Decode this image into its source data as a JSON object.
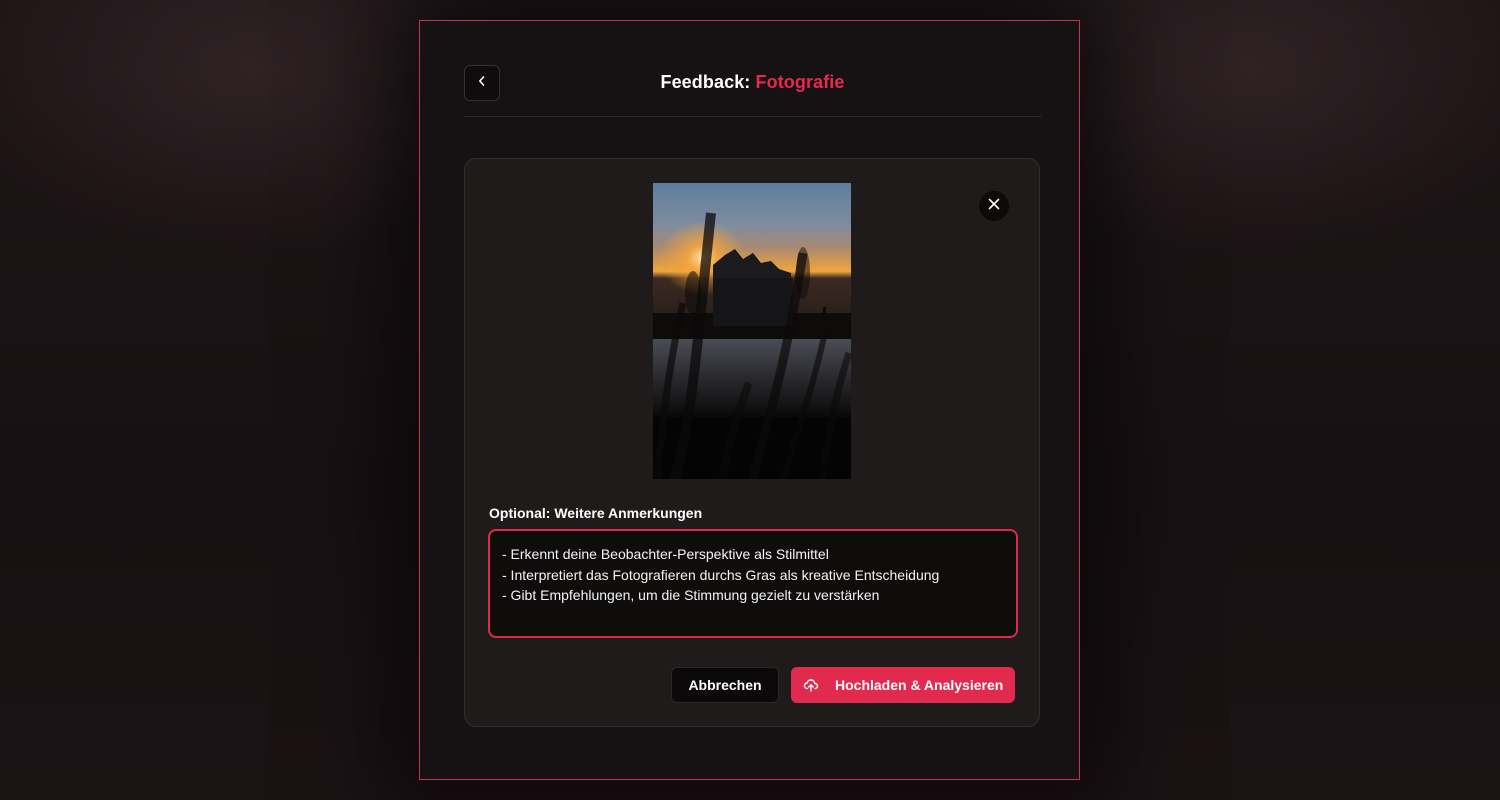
{
  "header": {
    "title_prefix": "Feedback:",
    "title_topic": "Fotografie"
  },
  "notes": {
    "label": "Optional: Weitere Anmerkungen",
    "value": "- Erkennt deine Beobachter-Perspektive als Stilmittel\n- Interpretiert das Fotografieren durchs Gras als kreative Entscheidung\n- Gibt Empfehlungen, um die Stimmung gezielt zu verstärken"
  },
  "actions": {
    "cancel_label": "Abbrechen",
    "upload_label": "Hochladen & Analysieren"
  },
  "icons": {
    "back": "chevron-left-icon",
    "close": "close-icon",
    "upload": "cloud-upload-icon"
  },
  "colors": {
    "accent": "#e12a4e",
    "background": "#161113",
    "card": "#1f1b1a"
  }
}
